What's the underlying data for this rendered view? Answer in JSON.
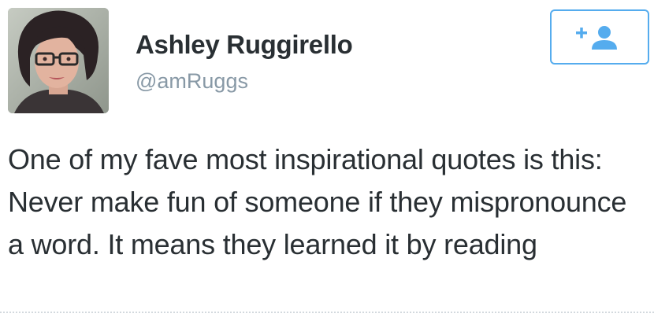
{
  "tweet": {
    "author": {
      "display_name": "Ashley Ruggirello",
      "handle": "@amRuggs",
      "avatar_icon": "profile-photo"
    },
    "follow_button": {
      "icon": "add-user-icon",
      "color": "#55acee"
    },
    "text": "One of my fave most inspirational quotes is this: Never make fun of someone if they mispronounce a word. It means they learned it by reading"
  },
  "colors": {
    "accent": "#55acee",
    "text": "#292f33",
    "muted": "#8899a6"
  }
}
